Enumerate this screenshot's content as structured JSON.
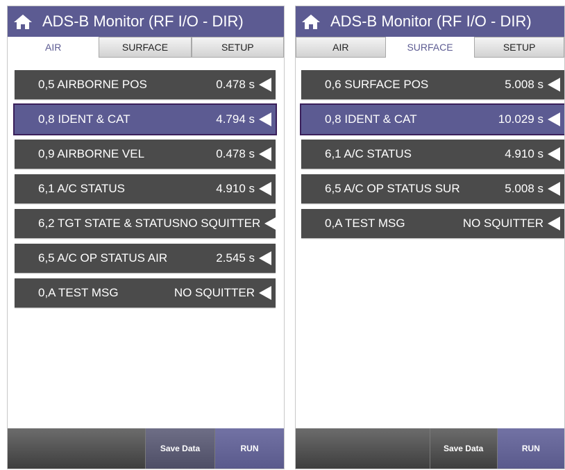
{
  "left": {
    "title": "ADS-B Monitor (RF I/O - DIR)",
    "tabs": [
      {
        "label": "AIR",
        "active": true
      },
      {
        "label": "SURFACE",
        "active": false
      },
      {
        "label": "SETUP",
        "active": false
      }
    ],
    "rows": [
      {
        "label": "0,5 AIRBORNE POS",
        "value": "0.478 s"
      },
      {
        "label": "0,8 IDENT & CAT",
        "value": "4.794 s",
        "selected": true
      },
      {
        "label": "0,9 AIRBORNE VEL",
        "value": "0.478 s"
      },
      {
        "label": "6,1 A/C STATUS",
        "value": "4.910 s"
      },
      {
        "label": "6,2 TGT STATE & STATUS",
        "value": "NO SQUITTER"
      },
      {
        "label": "6,5 A/C OP STATUS AIR",
        "value": "2.545 s"
      },
      {
        "label": "0,A TEST MSG",
        "value": "NO SQUITTER"
      }
    ],
    "bottom": {
      "save_label": "Save Data",
      "run_label": "RUN"
    }
  },
  "right": {
    "title": "ADS-B Monitor (RF I/O - DIR)",
    "tabs": [
      {
        "label": "AIR",
        "active": false
      },
      {
        "label": "SURFACE",
        "active": true
      },
      {
        "label": "SETUP",
        "active": false
      }
    ],
    "rows": [
      {
        "label": "0,6 SURFACE POS",
        "value": "5.008 s"
      },
      {
        "label": "0,8 IDENT & CAT",
        "value": "10.029 s",
        "selected": true
      },
      {
        "label": "6,1 A/C STATUS",
        "value": "4.910 s"
      },
      {
        "label": "6,5 A/C OP STATUS SUR",
        "value": "5.008 s"
      },
      {
        "label": "0,A TEST MSG",
        "value": "NO SQUITTER"
      }
    ],
    "bottom": {
      "save_label": "Save Data",
      "run_label": "RUN"
    }
  },
  "icons": {
    "home": "home-icon",
    "row_arrow": "left-triangle-icon"
  },
  "colors": {
    "titlebar": "#5c5b92",
    "row": "#4b4b4b",
    "row_selected": "#5c5b92",
    "active_tab_text": "#5c5b92"
  }
}
